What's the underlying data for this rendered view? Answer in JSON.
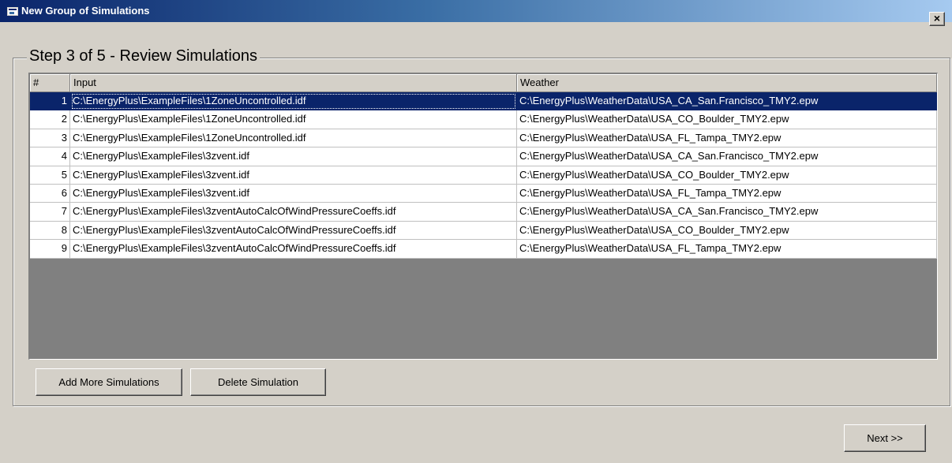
{
  "window": {
    "title": "New Group of Simulations",
    "close_label": "×"
  },
  "step": {
    "title": "Step 3 of 5 - Review Simulations"
  },
  "grid": {
    "columns": [
      "#",
      "Input",
      "Weather"
    ],
    "selected_row": 0,
    "rows": [
      {
        "num": "1",
        "input": "C:\\EnergyPlus\\ExampleFiles\\1ZoneUncontrolled.idf",
        "weather": "C:\\EnergyPlus\\WeatherData\\USA_CA_San.Francisco_TMY2.epw"
      },
      {
        "num": "2",
        "input": "C:\\EnergyPlus\\ExampleFiles\\1ZoneUncontrolled.idf",
        "weather": "C:\\EnergyPlus\\WeatherData\\USA_CO_Boulder_TMY2.epw"
      },
      {
        "num": "3",
        "input": "C:\\EnergyPlus\\ExampleFiles\\1ZoneUncontrolled.idf",
        "weather": "C:\\EnergyPlus\\WeatherData\\USA_FL_Tampa_TMY2.epw"
      },
      {
        "num": "4",
        "input": "C:\\EnergyPlus\\ExampleFiles\\3zvent.idf",
        "weather": "C:\\EnergyPlus\\WeatherData\\USA_CA_San.Francisco_TMY2.epw"
      },
      {
        "num": "5",
        "input": "C:\\EnergyPlus\\ExampleFiles\\3zvent.idf",
        "weather": "C:\\EnergyPlus\\WeatherData\\USA_CO_Boulder_TMY2.epw"
      },
      {
        "num": "6",
        "input": "C:\\EnergyPlus\\ExampleFiles\\3zvent.idf",
        "weather": "C:\\EnergyPlus\\WeatherData\\USA_FL_Tampa_TMY2.epw"
      },
      {
        "num": "7",
        "input": "C:\\EnergyPlus\\ExampleFiles\\3zventAutoCalcOfWindPressureCoeffs.idf",
        "weather": "C:\\EnergyPlus\\WeatherData\\USA_CA_San.Francisco_TMY2.epw"
      },
      {
        "num": "8",
        "input": "C:\\EnergyPlus\\ExampleFiles\\3zventAutoCalcOfWindPressureCoeffs.idf",
        "weather": "C:\\EnergyPlus\\WeatherData\\USA_CO_Boulder_TMY2.epw"
      },
      {
        "num": "9",
        "input": "C:\\EnergyPlus\\ExampleFiles\\3zventAutoCalcOfWindPressureCoeffs.idf",
        "weather": "C:\\EnergyPlus\\WeatherData\\USA_FL_Tampa_TMY2.epw"
      }
    ]
  },
  "buttons": {
    "add_more": "Add More Simulations",
    "delete": "Delete Simulation",
    "next": "Next >>"
  },
  "colors": {
    "face": "#d4d0c8",
    "title_start": "#0a246a",
    "title_end": "#a6caf0",
    "selection": "#0a246a",
    "grid_empty": "#808080"
  },
  "icons": {
    "title_icon": "app-window-icon",
    "close_icon": "close-icon"
  }
}
